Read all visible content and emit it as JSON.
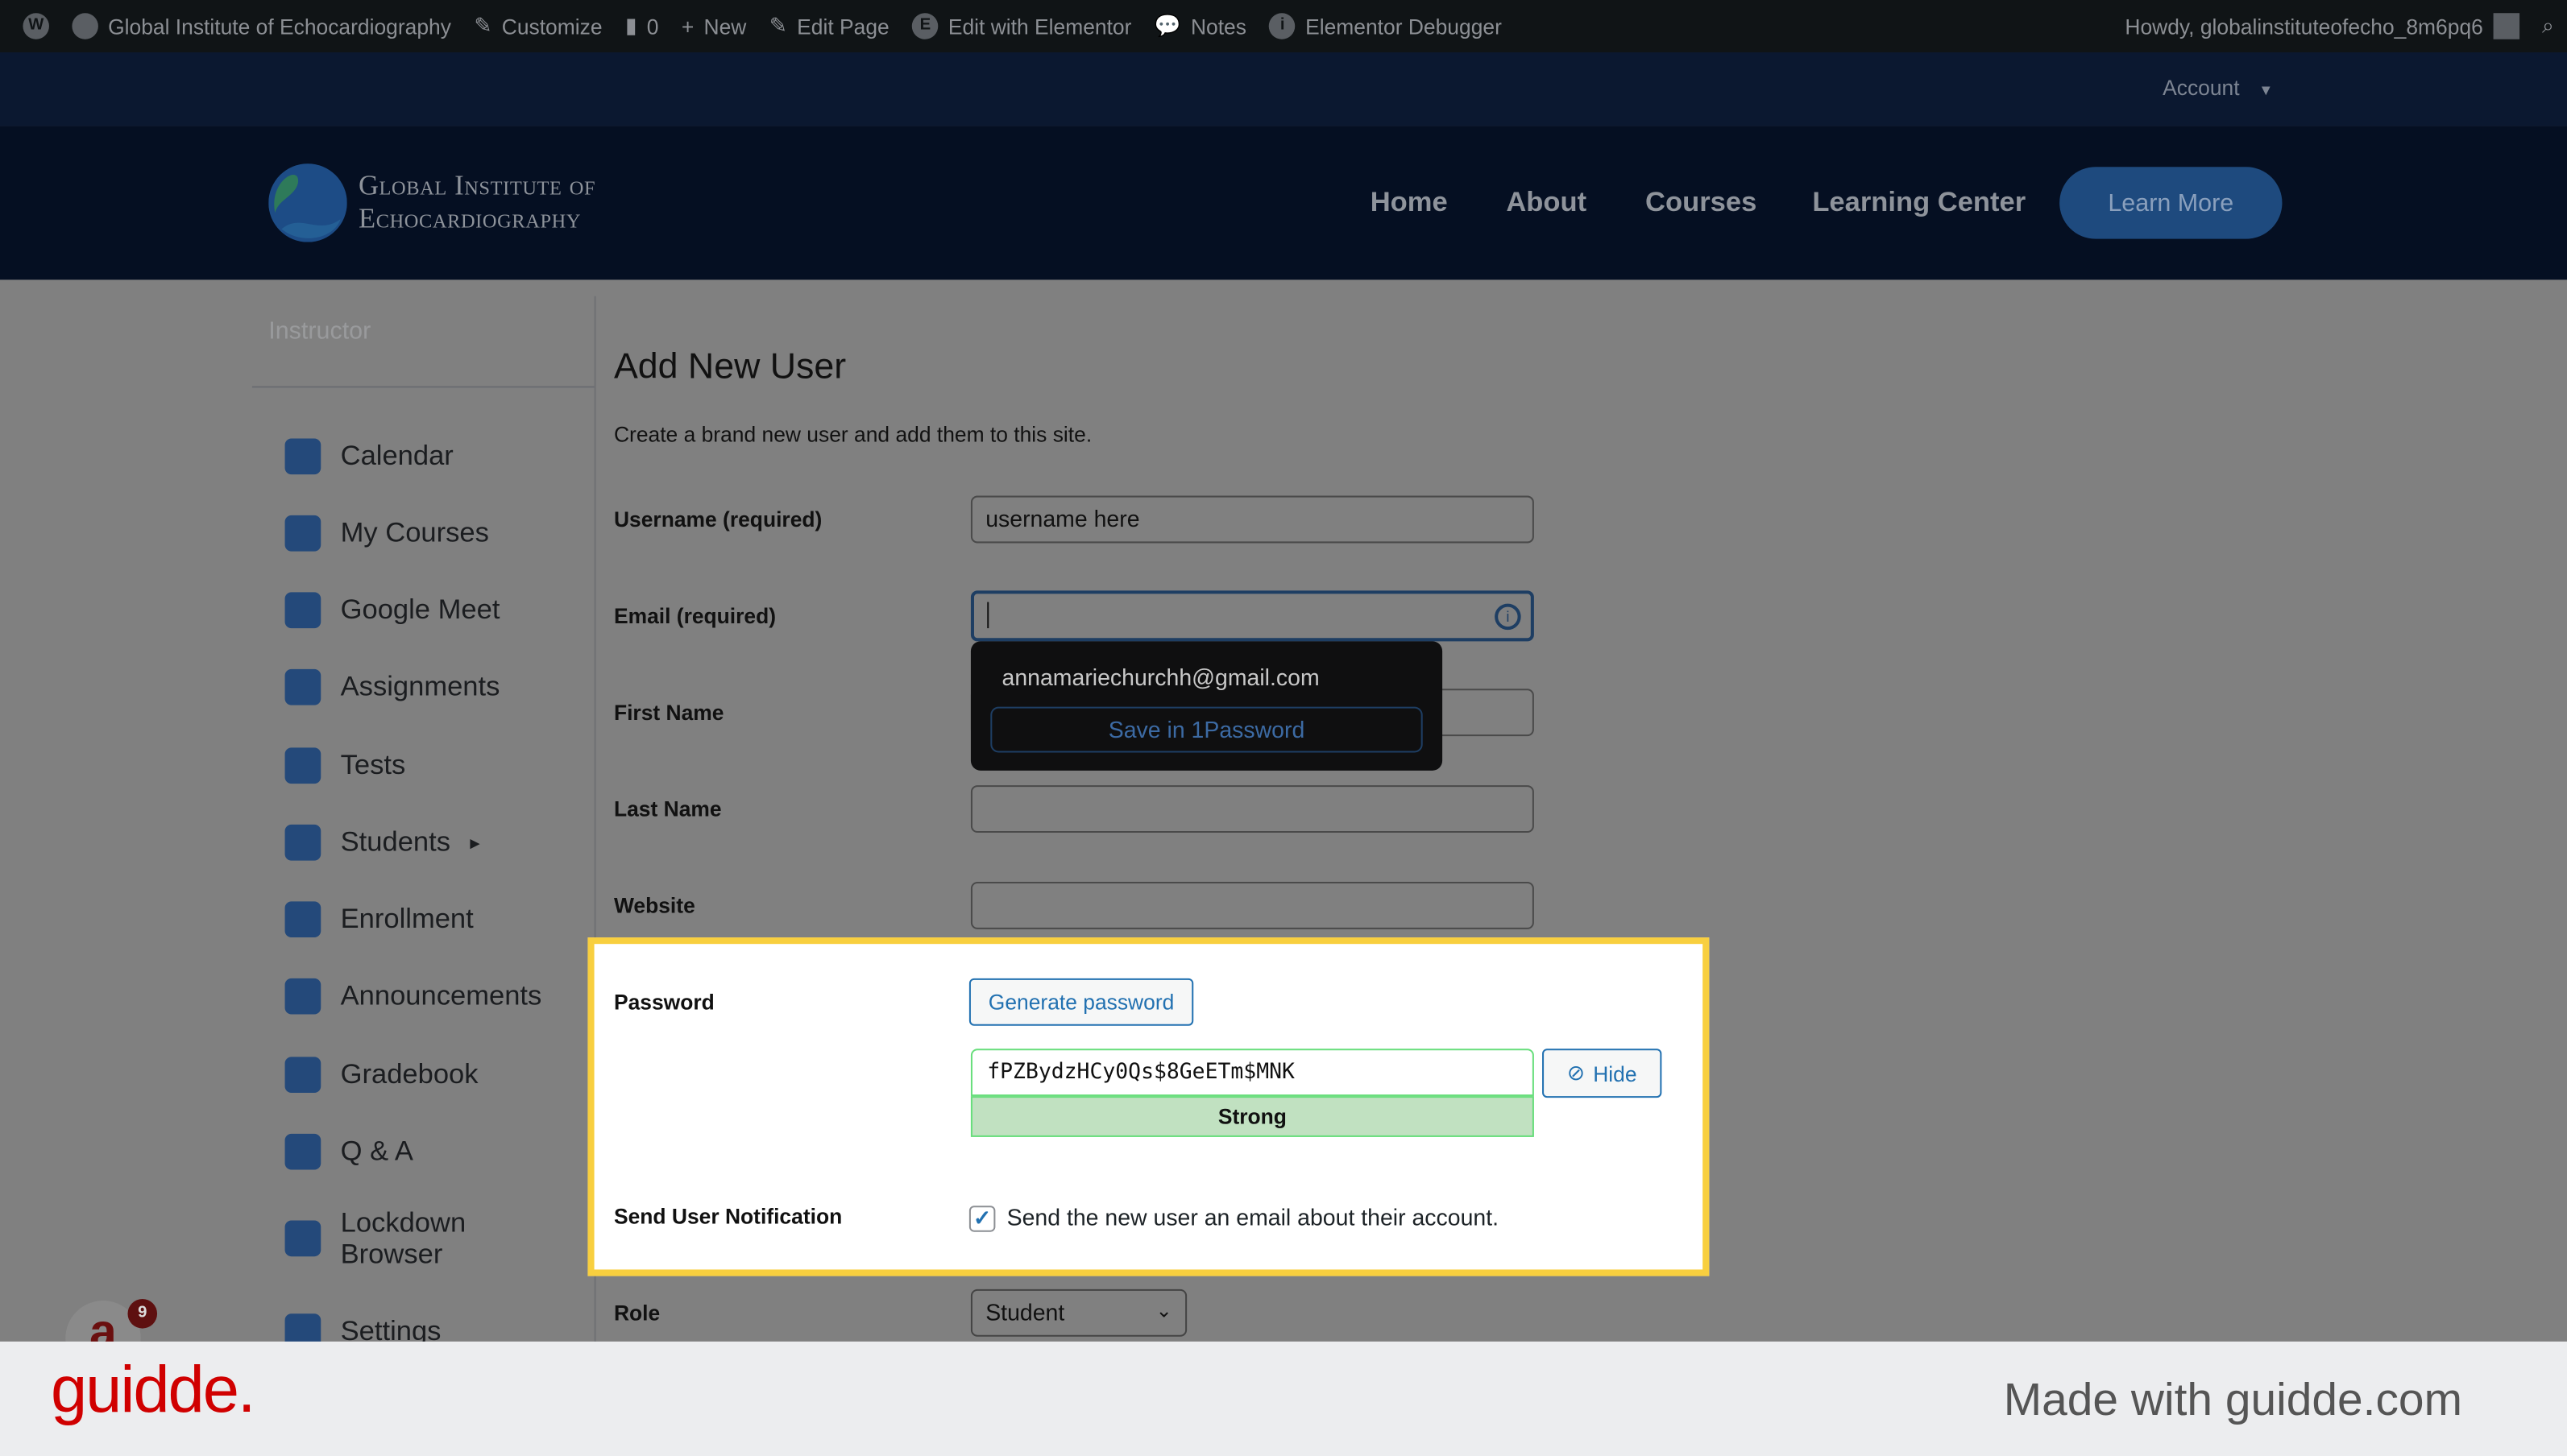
{
  "adminbar": {
    "site": "Global Institute of Echocardiography",
    "customize": "Customize",
    "comments": "0",
    "new": "New",
    "edit_page": "Edit Page",
    "edit_elementor": "Edit with Elementor",
    "notes": "Notes",
    "debugger": "Elementor Debugger",
    "howdy": "Howdy, globalinstituteofecho_8m6pq6"
  },
  "account": {
    "label": "Account"
  },
  "header": {
    "logo_line1": "Global Institute of",
    "logo_line2": "Echocardiography",
    "nav": [
      "Home",
      "About",
      "Courses",
      "Learning Center"
    ],
    "cta": "Learn More"
  },
  "sidebar": {
    "heading": "Instructor",
    "items": [
      {
        "label": "Calendar",
        "icon": "calendar-icon"
      },
      {
        "label": "My Courses",
        "icon": "rocket-icon"
      },
      {
        "label": "Google Meet",
        "icon": "video-icon"
      },
      {
        "label": "Assignments",
        "icon": "assignments-icon"
      },
      {
        "label": "Tests",
        "icon": "tests-icon"
      },
      {
        "label": "Students",
        "icon": "graduation-cap-icon"
      },
      {
        "label": "Enrollment",
        "icon": "user-icon"
      },
      {
        "label": "Announcements",
        "icon": "megaphone-icon"
      },
      {
        "label": "Gradebook",
        "icon": "gradebook-icon"
      },
      {
        "label": "Q & A",
        "icon": "qa-icon"
      },
      {
        "label": "Lockdown Browser",
        "icon": "lock-icon"
      },
      {
        "label": "Settings",
        "icon": "gear-icon"
      }
    ],
    "badge_count": "9"
  },
  "form": {
    "title": "Add New User",
    "description": "Create a brand new user and add them to this site.",
    "username_label": "Username (required)",
    "username_value": "username here",
    "email_label": "Email (required)",
    "email_value": "",
    "first_name_label": "First Name",
    "last_name_label": "Last Name",
    "website_label": "Website",
    "password_label": "Password",
    "generate_label": "Generate password",
    "password_value": "fPZBydzHCy0Qs$8GeETm$MNK",
    "hide_label": "Hide",
    "strength": "Strong",
    "notify_label": "Send User Notification",
    "notify_text": "Send the new user an email about their account.",
    "notify_checked": true,
    "role_label": "Role",
    "role_value": "Student"
  },
  "autofill": {
    "email": "annamariechurchh@gmail.com",
    "save": "Save in 1Password"
  },
  "footer": {
    "brand": "guidde.",
    "made_with": "Made with guidde.com"
  },
  "colors": {
    "highlight": "#f8cf3f",
    "accent": "#2271b1",
    "strong": "#c1e1c1",
    "brand": "#d00000"
  }
}
